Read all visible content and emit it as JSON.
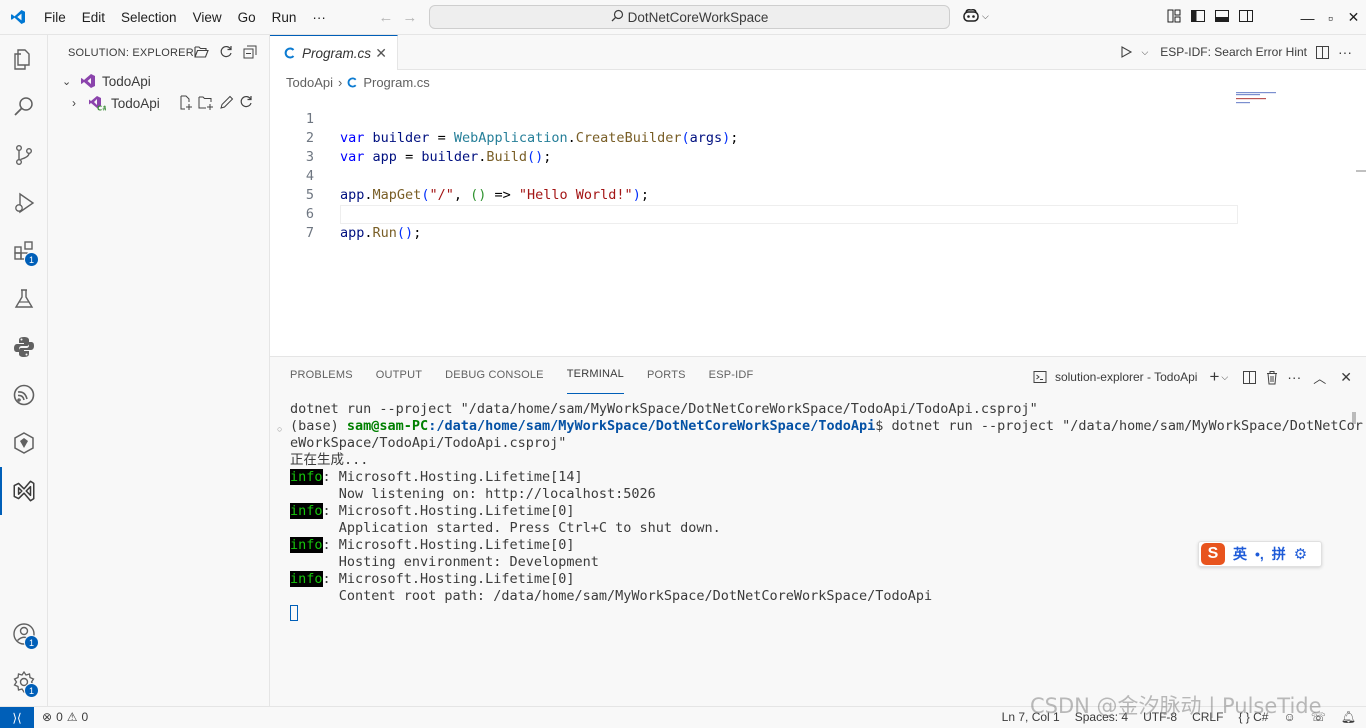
{
  "titlebar": {
    "menus": [
      "File",
      "Edit",
      "Selection",
      "View",
      "Go",
      "Run",
      "···"
    ],
    "command_center": "DotNetCoreWorkSpace"
  },
  "activity_bar": {
    "items": [
      {
        "name": "explorer-icon"
      },
      {
        "name": "search-icon"
      },
      {
        "name": "source-control-icon"
      },
      {
        "name": "run-debug-icon"
      },
      {
        "name": "extensions-icon",
        "badge": "1"
      },
      {
        "name": "testing-icon"
      },
      {
        "name": "python-icon"
      },
      {
        "name": "esp-idf-icon"
      },
      {
        "name": "copilot-icon"
      },
      {
        "name": "solution-explorer-icon"
      }
    ],
    "accounts_badge": "1",
    "manage_badge": "1"
  },
  "sidebar": {
    "title": "SOLUTION: EXPLORER",
    "solution": "TodoApi",
    "project": "TodoApi"
  },
  "editor": {
    "tab_label": "Program.cs",
    "actions_label": "ESP-IDF: Search Error Hint",
    "breadcrumb": [
      "TodoApi",
      "Program.cs"
    ],
    "line_numbers": [
      "1",
      "2",
      "3",
      "4",
      "5",
      "6",
      "7"
    ]
  },
  "panel": {
    "tabs": [
      "PROBLEMS",
      "OUTPUT",
      "DEBUG CONSOLE",
      "TERMINAL",
      "PORTS",
      "ESP-IDF"
    ],
    "active_tab": "TERMINAL",
    "terminal_name": "solution-explorer - TodoApi",
    "terminal": {
      "line1": "dotnet run --project \"/data/home/sam/MyWorkSpace/DotNetCoreWorkSpace/TodoApi/TodoApi.csproj\"",
      "prompt_env": "(base) ",
      "prompt_user": "sam@sam-PC",
      "prompt_path": ":/data/home/sam/MyWorkSpace/DotNetCoreWorkSpace/TodoApi",
      "prompt_cmd": "$ dotnet run --project \"/data/home/sam/MyWorkSpace/DotNetCor",
      "wrap": "eWorkSpace/TodoApi/TodoApi.csproj\"",
      "building": "正在生成...",
      "info_tag": "info",
      "log1": ": Microsoft.Hosting.Lifetime[14]",
      "log1b": "      Now listening on: http://localhost:5026",
      "log2": ": Microsoft.Hosting.Lifetime[0]",
      "log2b": "      Application started. Press Ctrl+C to shut down.",
      "log3": ": Microsoft.Hosting.Lifetime[0]",
      "log3b": "      Hosting environment: Development",
      "log4": ": Microsoft.Hosting.Lifetime[0]",
      "log4b": "      Content root path: /data/home/sam/MyWorkSpace/DotNetCoreWorkSpace/TodoApi"
    }
  },
  "ime": {
    "mode": "英",
    "punct": "•,",
    "input": "拼"
  },
  "statusbar": {
    "errors": "0",
    "warnings": "0",
    "position": "Ln 7, Col 1",
    "spaces": "Spaces: 4",
    "encoding": "UTF-8",
    "eol": "CRLF",
    "language": "C#"
  },
  "watermark": "CSDN @金汐脉动 | PulseTide",
  "colors": {
    "accent": "#005fb8",
    "info_bg": "#000000",
    "info_fg": "#16c60c"
  }
}
